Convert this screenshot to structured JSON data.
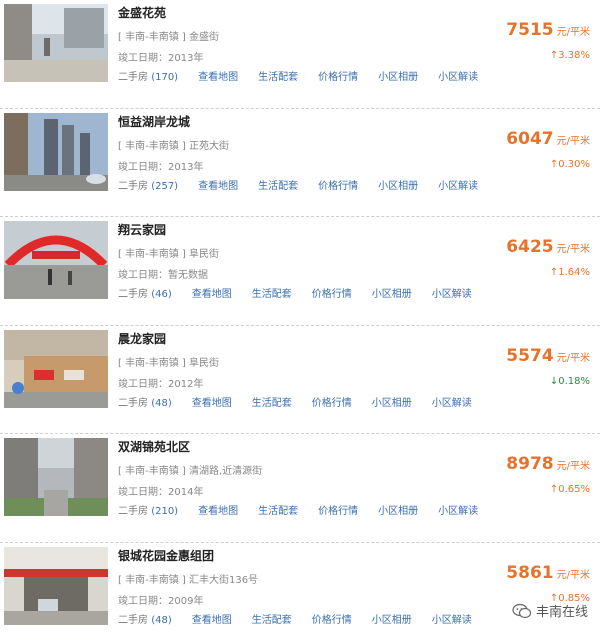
{
  "listings": [
    {
      "name": "金盛花苑",
      "area": "[ 丰南-丰南镇 ]",
      "street": "金盛街",
      "year_label": "竣工日期：",
      "year": "2013年",
      "secondhand_label": "二手房",
      "secondhand_count": "(170)",
      "price": "7515",
      "unit": "元/平米",
      "trend_arrow": "↑",
      "change": "3.38%",
      "dir": "up",
      "thumb": "street"
    },
    {
      "name": "恒益湖岸龙城",
      "area": "[ 丰南-丰南镇 ]",
      "street": "正苑大街",
      "year_label": "竣工日期：",
      "year": "2013年",
      "secondhand_label": "二手房",
      "secondhand_count": "(257)",
      "price": "6047",
      "unit": "元/平米",
      "trend_arrow": "↑",
      "change": "0.30%",
      "dir": "up",
      "thumb": "towers"
    },
    {
      "name": "翔云家园",
      "area": "[ 丰南-丰南镇 ]",
      "street": "阜民街",
      "year_label": "竣工日期：",
      "year": "暂无数据",
      "secondhand_label": "二手房",
      "secondhand_count": "(46)",
      "price": "6425",
      "unit": "元/平米",
      "trend_arrow": "↑",
      "change": "1.64%",
      "dir": "up",
      "thumb": "arch"
    },
    {
      "name": "晨龙家园",
      "area": "[ 丰南-丰南镇 ]",
      "street": "阜民街",
      "year_label": "竣工日期：",
      "year": "2012年",
      "secondhand_label": "二手房",
      "secondhand_count": "(48)",
      "price": "5574",
      "unit": "元/平米",
      "trend_arrow": "↓",
      "change": "0.18%",
      "dir": "down",
      "thumb": "shops"
    },
    {
      "name": "双湖锦苑北区",
      "area": "[ 丰南-丰南镇 ]",
      "street": "清湖路,近清源街",
      "year_label": "竣工日期：",
      "year": "2014年",
      "secondhand_label": "二手房",
      "secondhand_count": "(210)",
      "price": "8978",
      "unit": "元/平米",
      "trend_arrow": "↑",
      "change": "0.65%",
      "dir": "up",
      "thumb": "alley"
    },
    {
      "name": "银城花园金惠组团",
      "area": "[ 丰南-丰南镇 ]",
      "street": "汇丰大街136号",
      "year_label": "竣工日期：",
      "year": "2009年",
      "secondhand_label": "二手房",
      "secondhand_count": "(48)",
      "price": "5861",
      "unit": "元/平米",
      "trend_arrow": "↑",
      "change": "0.85%",
      "dir": "up",
      "thumb": "gate"
    }
  ],
  "links": [
    "查看地图",
    "生活配套",
    "价格行情",
    "小区相册",
    "小区解读"
  ],
  "watermark": "丰南在线",
  "colors": {
    "price": "#e8722a",
    "link": "#3a6fb0",
    "down": "#2e8b3a"
  }
}
